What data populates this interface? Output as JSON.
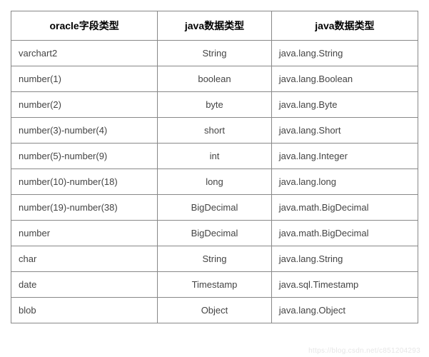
{
  "table": {
    "headers": [
      "oracle字段类型",
      "java数据类型",
      "java数据类型"
    ],
    "rows": [
      {
        "c1": "varchart2",
        "c2": "String",
        "c3": "java.lang.String"
      },
      {
        "c1": "number(1)",
        "c2": "boolean",
        "c3": "java.lang.Boolean"
      },
      {
        "c1": "number(2)",
        "c2": "byte",
        "c3": "java.lang.Byte"
      },
      {
        "c1": "number(3)-number(4)",
        "c2": "short",
        "c3": "java.lang.Short"
      },
      {
        "c1": "number(5)-number(9)",
        "c2": "int",
        "c3": "java.lang.Integer"
      },
      {
        "c1": "number(10)-number(18)",
        "c2": "long",
        "c3": "java.lang.long"
      },
      {
        "c1": "number(19)-number(38)",
        "c2": "BigDecimal",
        "c3": "java.math.BigDecimal"
      },
      {
        "c1": "number",
        "c2": "BigDecimal",
        "c3": "java.math.BigDecimal"
      },
      {
        "c1": "char",
        "c2": "String",
        "c3": "java.lang.String"
      },
      {
        "c1": "date",
        "c2": "Timestamp",
        "c3": "java.sql.Timestamp"
      },
      {
        "c1": "blob",
        "c2": "Object",
        "c3": "java.lang.Object"
      }
    ]
  },
  "watermark": "https://blog.csdn.net/c851204293"
}
